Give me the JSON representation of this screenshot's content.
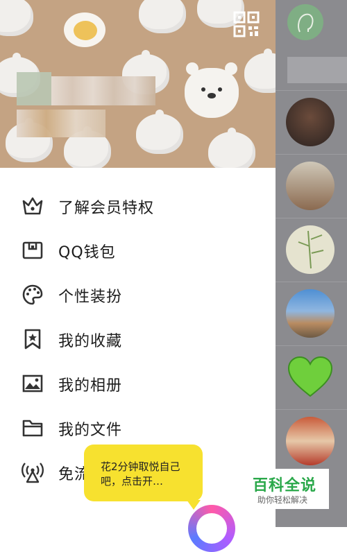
{
  "menu": {
    "items": [
      {
        "label": "了解会员特权",
        "icon": "crown-icon"
      },
      {
        "label": "QQ钱包",
        "icon": "wallet-icon"
      },
      {
        "label": "个性装扮",
        "icon": "palette-icon"
      },
      {
        "label": "我的收藏",
        "icon": "bookmark-star-icon"
      },
      {
        "label": "我的相册",
        "icon": "photo-icon"
      },
      {
        "label": "我的文件",
        "icon": "folder-icon"
      },
      {
        "label": "免流",
        "icon": "broadcast-icon"
      }
    ]
  },
  "tooltip": {
    "text": "花2分钟取悦自己吧，点击开…"
  },
  "watermark": {
    "title": "百科全说",
    "subtitle": "助你轻松解决"
  },
  "colors": {
    "header_bg": "#c4a383",
    "overlay": "#8b8b8f",
    "tooltip_bg": "#f7e12f",
    "icon": "#333333"
  }
}
